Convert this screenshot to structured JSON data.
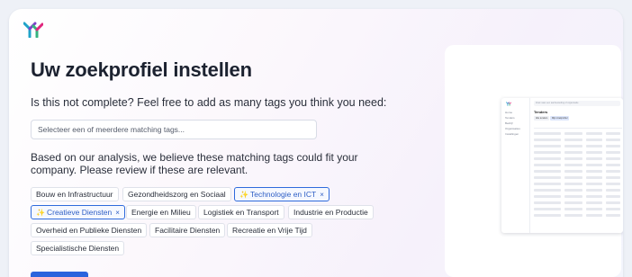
{
  "header": {
    "logo_icon": "brand-logo-icon",
    "title": "Uw zoekprofiel instellen"
  },
  "intro": {
    "text": "Is this not complete? Feel free to add as many tags you think you need:",
    "select_placeholder": "Selecteer een of meerdere matching tags..."
  },
  "analysis": {
    "text": "Based on our analysis, we believe these matching tags could fit your company. Please review if these are relevant."
  },
  "tags": [
    {
      "label": "Bouw en Infrastructuur",
      "selected": false
    },
    {
      "label": "Gezondheidszorg en Sociaal",
      "selected": false
    },
    {
      "label": "Technologie en ICT",
      "selected": true
    },
    {
      "label": "Creatieve Diensten",
      "selected": true
    },
    {
      "label": "Energie en Milieu",
      "selected": false
    },
    {
      "label": "Logistiek en Transport",
      "selected": false
    },
    {
      "label": "Industrie en Productie",
      "selected": false
    },
    {
      "label": "Overheid en Publieke Diensten",
      "selected": false
    },
    {
      "label": "Facilitaire Diensten",
      "selected": false
    },
    {
      "label": "Recreatie en Vrije Tijd",
      "selected": false
    },
    {
      "label": "Specialistische Diensten",
      "selected": false
    }
  ],
  "tag_remove_symbol": "×",
  "tag_sparkle_symbol": "✨",
  "colors": {
    "accent": "#2a64dd",
    "selected_border": "#2f6bdc",
    "title": "#1c2230"
  },
  "preview": {
    "search_text": "Zoek naar een aanbesteding of organisatie",
    "title": "Tenders",
    "tabs": [
      "Alle tenders",
      "Mijn zoekprofiel"
    ],
    "nav": [
      "Home",
      "Tenders",
      "Bedrijf",
      "Organisaties",
      "Instellingen"
    ]
  }
}
